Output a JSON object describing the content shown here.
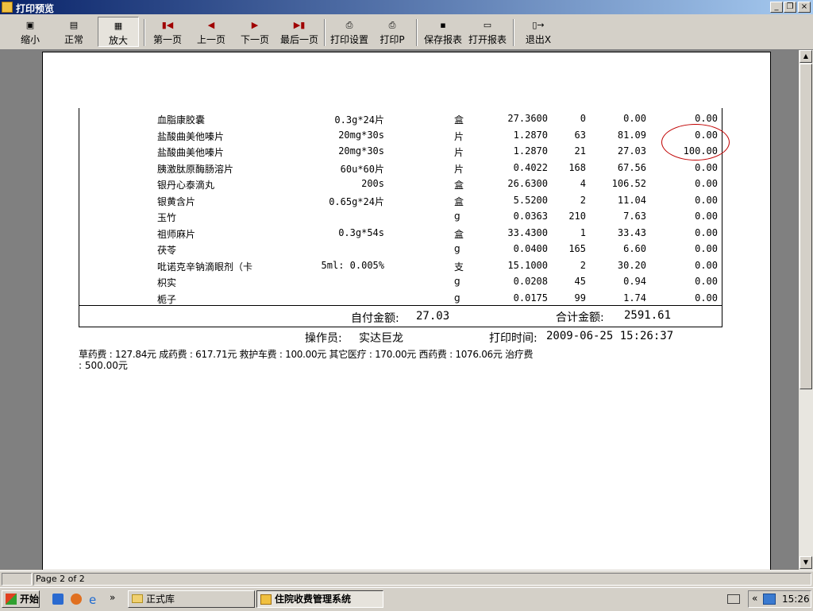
{
  "window": {
    "title": "打印预览",
    "minimize": "_",
    "restore": "❐",
    "close": "×"
  },
  "toolbar": {
    "zoom_out": "缩小",
    "normal": "正常",
    "zoom_in": "放大",
    "first_page": "第一页",
    "prev_page": "上一页",
    "next_page": "下一页",
    "last_page": "最后一页",
    "print_setup": "打印设置",
    "print": "打印P",
    "save_report": "保存报表",
    "open_report": "打开报表",
    "exit": "退出X"
  },
  "report": {
    "rows": [
      {
        "name": "血脂康胶囊",
        "spec": "0.3g*24片",
        "unit": "盒",
        "price": "27.3600",
        "qty": "0",
        "amount": "0.00",
        "self_pay": "0.00"
      },
      {
        "name": "盐酸曲美他嗪片",
        "spec": "20mg*30s",
        "unit": "片",
        "price": "1.2870",
        "qty": "63",
        "amount": "81.09",
        "self_pay": "0.00"
      },
      {
        "name": "盐酸曲美他嗪片",
        "spec": "20mg*30s",
        "unit": "片",
        "price": "1.2870",
        "qty": "21",
        "amount": "27.03",
        "self_pay": "100.00"
      },
      {
        "name": "胰激肽原酶肠溶片",
        "spec": "60u*60片",
        "unit": "片",
        "price": "0.4022",
        "qty": "168",
        "amount": "67.56",
        "self_pay": "0.00"
      },
      {
        "name": "银丹心泰滴丸",
        "spec": "200s",
        "unit": "盒",
        "price": "26.6300",
        "qty": "4",
        "amount": "106.52",
        "self_pay": "0.00"
      },
      {
        "name": "银黄含片",
        "spec": "0.65g*24片",
        "unit": "盒",
        "price": "5.5200",
        "qty": "2",
        "amount": "11.04",
        "self_pay": "0.00"
      },
      {
        "name": "玉竹",
        "spec": "",
        "unit": "g",
        "price": "0.0363",
        "qty": "210",
        "amount": "7.63",
        "self_pay": "0.00"
      },
      {
        "name": "祖师麻片",
        "spec": "0.3g*54s",
        "unit": "盒",
        "price": "33.4300",
        "qty": "1",
        "amount": "33.43",
        "self_pay": "0.00"
      },
      {
        "name": "茯苓",
        "spec": "",
        "unit": "g",
        "price": "0.0400",
        "qty": "165",
        "amount": "6.60",
        "self_pay": "0.00"
      },
      {
        "name": "吡诺克辛钠滴眼剂（卡",
        "spec": "5ml: 0.005%",
        "unit": "支",
        "price": "15.1000",
        "qty": "2",
        "amount": "30.20",
        "self_pay": "0.00"
      },
      {
        "name": "枳实",
        "spec": "",
        "unit": "g",
        "price": "0.0208",
        "qty": "45",
        "amount": "0.94",
        "self_pay": "0.00"
      },
      {
        "name": "栀子",
        "spec": "",
        "unit": "g",
        "price": "0.0175",
        "qty": "99",
        "amount": "1.74",
        "self_pay": "0.00"
      }
    ],
    "self_pay_label": "自付金额:",
    "self_pay_value": "27.03",
    "total_label": "合计金额:",
    "total_value": "2591.61",
    "operator_label": "操作员:",
    "operator_value": "实达巨龙",
    "print_time_label": "打印时间:",
    "print_time_value": "2009-06-25 15:26:37",
    "fees_line1": "草药费 : 127.84元    成药费 : 617.71元    救护车费 : 100.00元    其它医疗 : 170.00元    西药费 : 1076.06元    治疗费",
    "fees_line2": ": 500.00元"
  },
  "status": {
    "page": "Page 2 of 2"
  },
  "taskbar": {
    "start": "开始",
    "task1": "正式库",
    "task2": "住院收费管理系统",
    "clock": "15:26",
    "more": "»",
    "collapse": "«"
  },
  "colors": {
    "title_start": "#0a246a",
    "title_end": "#a6caf0",
    "annotation_circle": "#c00000"
  }
}
